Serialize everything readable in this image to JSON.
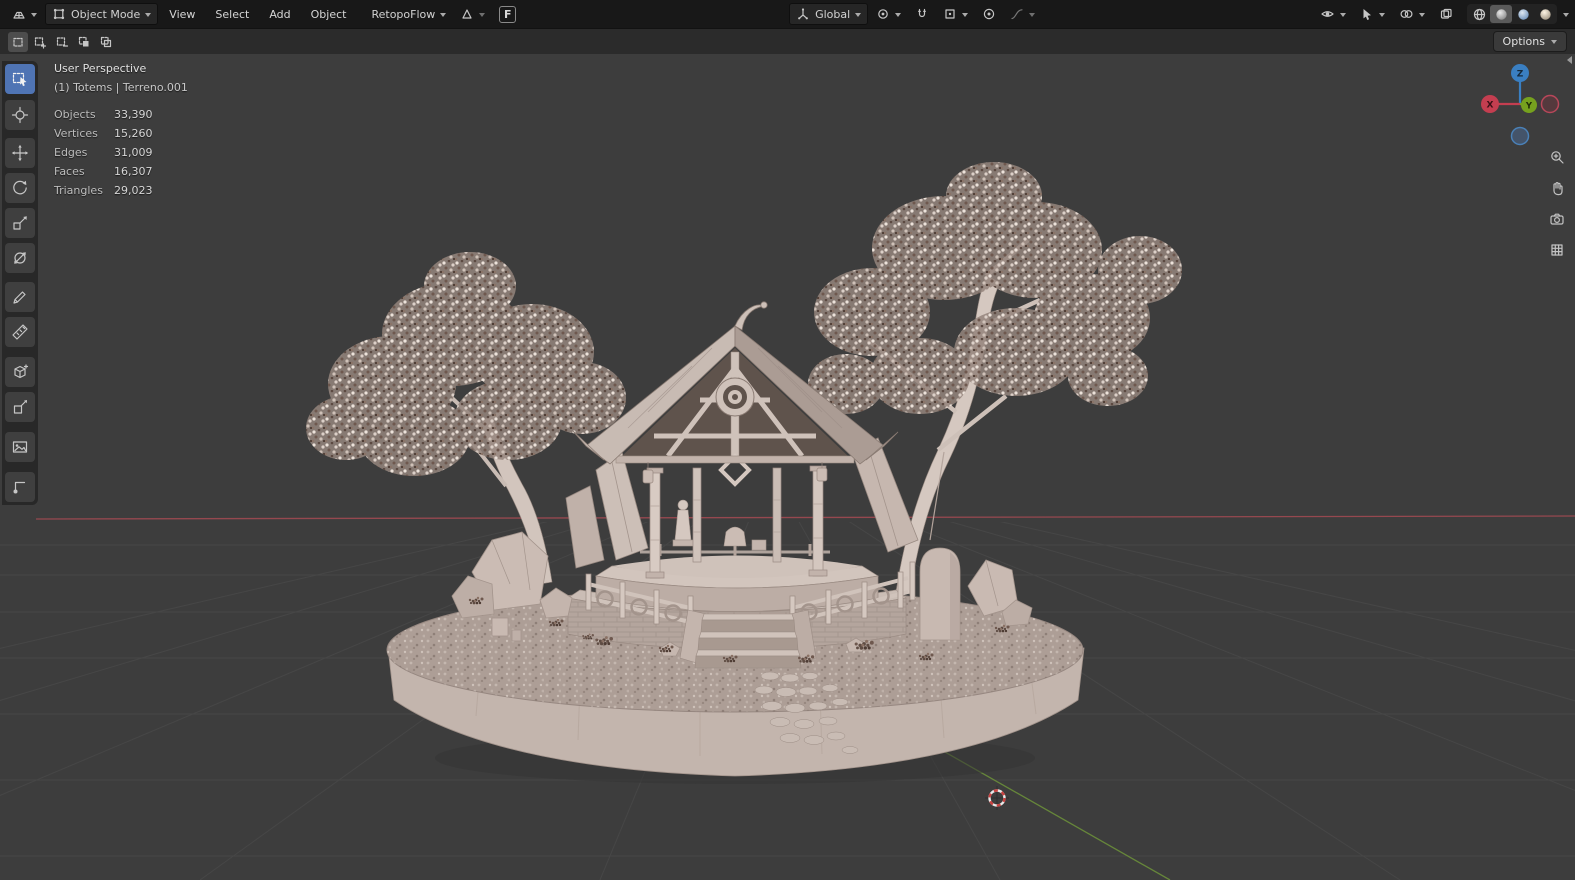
{
  "colors": {
    "accent_blue": "#4f74b4",
    "header_bg": "#181818",
    "toolrow_bg": "#2b2b2b",
    "viewport_bg": "#3d3d3d",
    "axis_x_red": "#a04a52",
    "axis_y_green": "#6b8f3a",
    "gizmo_x": "#c43e50",
    "gizmo_y": "#76a11e",
    "gizmo_z": "#3a7fc2",
    "clay": "#c8bbb3"
  },
  "header": {
    "mode_label": "Object Mode",
    "menus": [
      "View",
      "Select",
      "Add",
      "Object"
    ],
    "retopoflow_label": "RetopoFlow",
    "f_badge": "F",
    "orientation_label": "Global"
  },
  "tool_settings": {
    "options_label": "Options"
  },
  "viewport_overlay": {
    "view_label": "User Perspective",
    "scene_label": "(1) Totems | Terreno.001",
    "stats": [
      {
        "label": "Objects",
        "value": "33,390"
      },
      {
        "label": "Vertices",
        "value": "15,260"
      },
      {
        "label": "Edges",
        "value": "31,009"
      },
      {
        "label": "Faces",
        "value": "16,307"
      },
      {
        "label": "Triangles",
        "value": "29,023"
      }
    ]
  },
  "nav_gizmo": {
    "x_label": "X",
    "y_label": "Y",
    "z_label": "Z"
  },
  "scene": {
    "description": "Monochrome clay render: shrine pavilion on an oval island with stone steps, ring fence, rocks and two speckled trees"
  }
}
